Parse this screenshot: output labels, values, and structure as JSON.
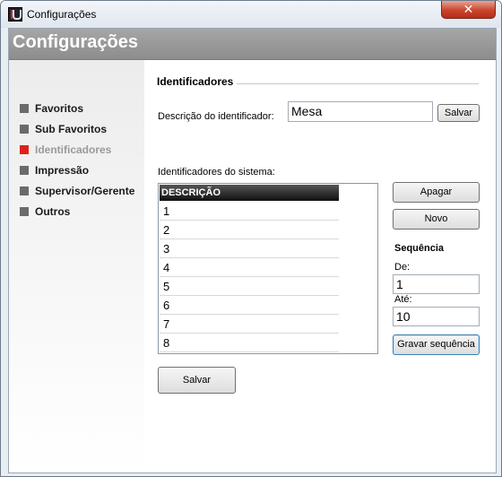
{
  "window": {
    "title": "Configurações",
    "close_glyph": "✕"
  },
  "header": {
    "title": "Configurações"
  },
  "sidebar": {
    "items": [
      {
        "label": "Favoritos",
        "active": false
      },
      {
        "label": "Sub Favoritos",
        "active": false
      },
      {
        "label": "Identificadores",
        "active": true
      },
      {
        "label": "Impressão",
        "active": false
      },
      {
        "label": "Supervisor/Gerente",
        "active": false
      },
      {
        "label": "Outros",
        "active": false
      }
    ],
    "colors": {
      "active": "#e0201b",
      "inactive": "#6b6b6b"
    }
  },
  "main": {
    "section_title": "Identificadores",
    "description_label": "Descrição do identificador:",
    "description_value": "Mesa",
    "save_small_label": "Salvar",
    "list_label": "Identificadores do sistema:",
    "list_header": "DESCRIÇÃO",
    "list_rows": [
      "1",
      "2",
      "3",
      "4",
      "5",
      "6",
      "7",
      "8"
    ],
    "delete_label": "Apagar",
    "new_label": "Novo",
    "sequence_title": "Sequência",
    "from_label": "De:",
    "from_value": "1",
    "to_label": "Até:",
    "to_value": "10",
    "save_sequence_label": "Gravar sequência",
    "save_label": "Salvar"
  }
}
